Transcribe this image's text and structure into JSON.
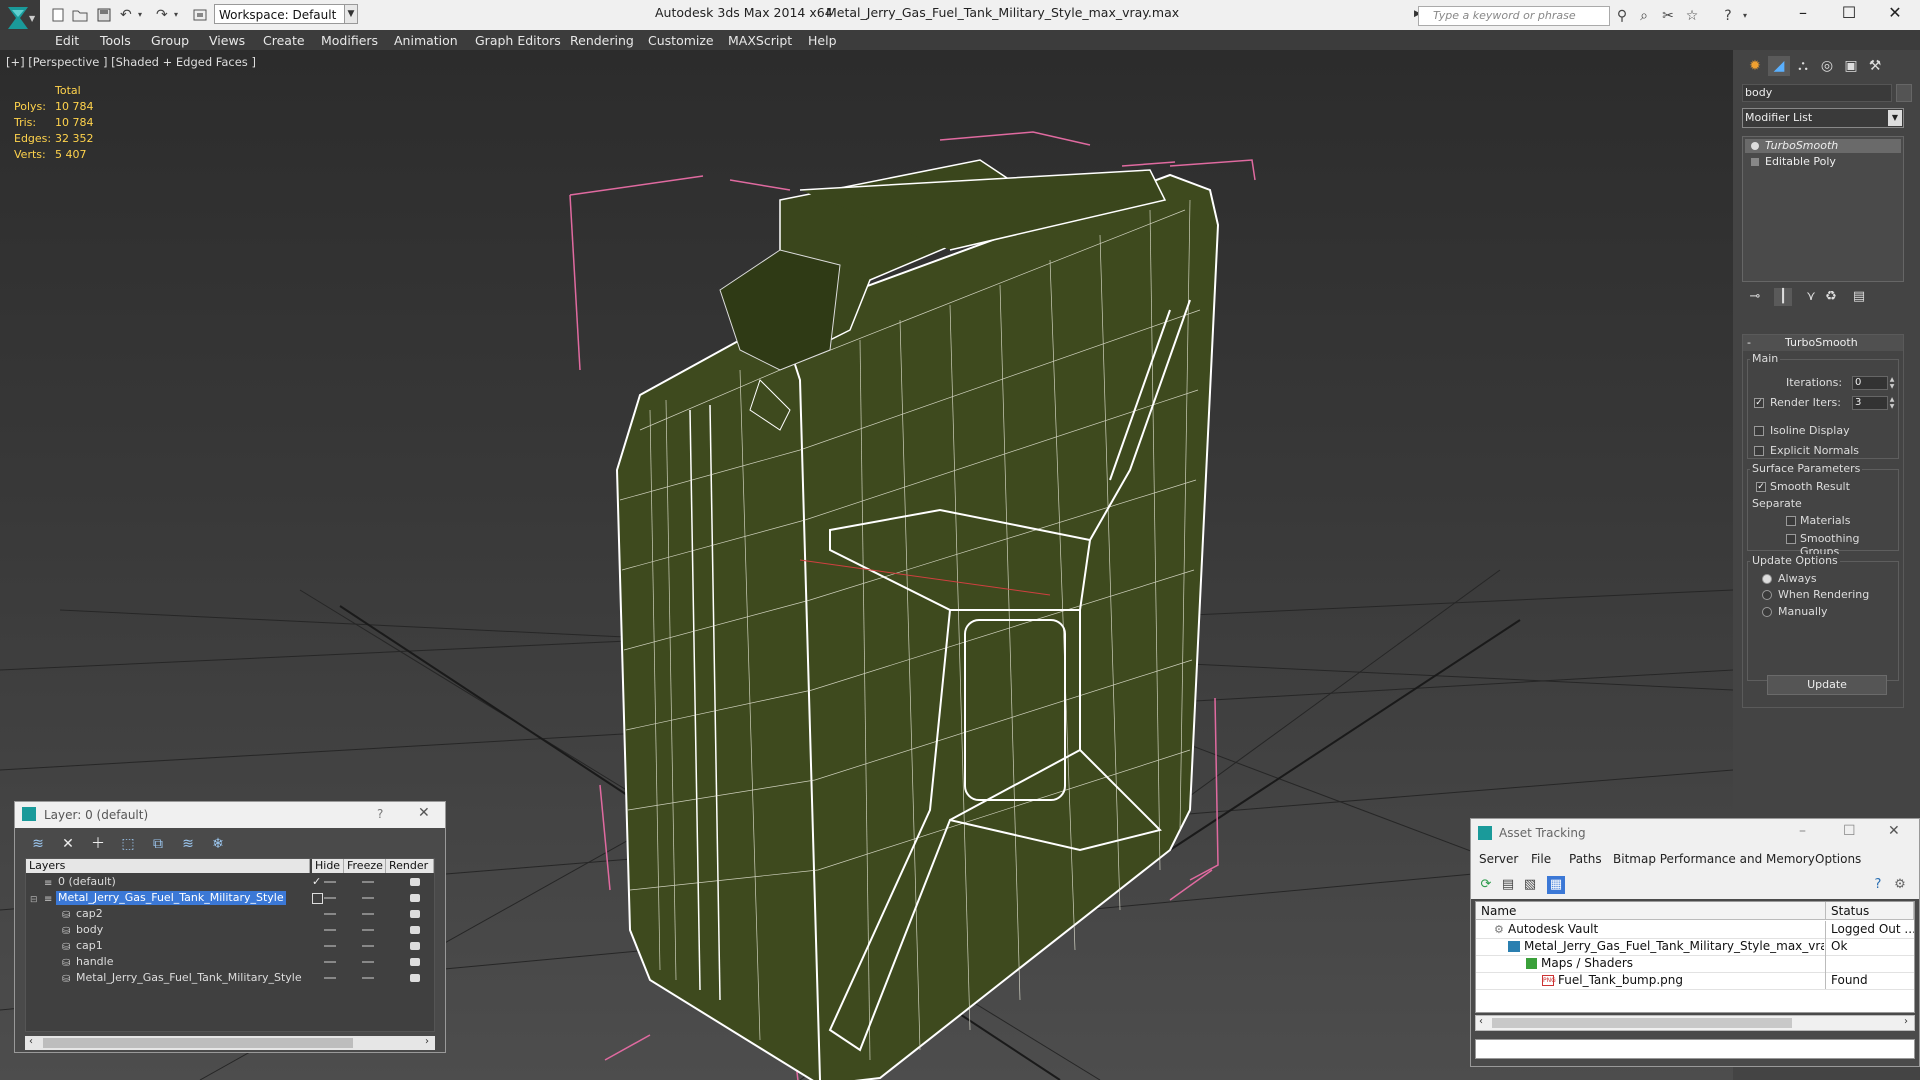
{
  "titlebar": {
    "workspace_label": "Workspace: Default",
    "app_title": "Autodesk 3ds Max  2014 x64",
    "file_title": "Metal_Jerry_Gas_Fuel_Tank_Military_Style_max_vray.max",
    "search_placeholder": "Type a keyword or phrase"
  },
  "menubar": [
    "Edit",
    "Tools",
    "Group",
    "Views",
    "Create",
    "Modifiers",
    "Animation",
    "Graph Editors",
    "Rendering",
    "Customize",
    "MAXScript",
    "Help"
  ],
  "viewport": {
    "label": "[+] [Perspective ] [Shaded + Edged Faces ]",
    "stats": {
      "header": "Total",
      "rows": [
        {
          "label": "Polys:",
          "value": "10 784"
        },
        {
          "label": "Tris:",
          "value": "10 784"
        },
        {
          "label": "Edges:",
          "value": "32 352"
        },
        {
          "label": "Verts:",
          "value": "5 407"
        }
      ]
    },
    "model_color": "#3e4a1e"
  },
  "command_panel": {
    "object_name": "body",
    "modifier_list": "Modifier List",
    "stack": [
      "TurboSmooth",
      "Editable Poly"
    ],
    "rollout_title": "TurboSmooth",
    "main_group": "Main",
    "iterations_label": "Iterations:",
    "iterations_value": "0",
    "render_iters_label": "Render Iters:",
    "render_iters_value": "3",
    "isoline_label": "Isoline Display",
    "explicit_normals_label": "Explicit Normals",
    "surface_group": "Surface Parameters",
    "smooth_result_label": "Smooth Result",
    "separate_label": "Separate",
    "materials_label": "Materials",
    "smoothing_groups_label": "Smoothing Groups",
    "update_group": "Update Options",
    "always_label": "Always",
    "when_rendering_label": "When Rendering",
    "manually_label": "Manually",
    "update_button": "Update"
  },
  "layer_window": {
    "title": "Layer: 0 (default)",
    "help": "?",
    "columns": [
      "Layers",
      "Hide",
      "Freeze",
      "Render"
    ],
    "rows": [
      {
        "name": "0 (default)",
        "indent": 0
      },
      {
        "name": "Metal_Jerry_Gas_Fuel_Tank_Military_Style",
        "indent": 0
      },
      {
        "name": "cap2",
        "indent": 1
      },
      {
        "name": "body",
        "indent": 1
      },
      {
        "name": "cap1",
        "indent": 1
      },
      {
        "name": "handle",
        "indent": 1
      },
      {
        "name": "Metal_Jerry_Gas_Fuel_Tank_Military_Style",
        "indent": 1
      }
    ]
  },
  "asset_window": {
    "title": "Asset Tracking",
    "menu": [
      "Server",
      "File",
      "Paths",
      "Bitmap Performance and Memory",
      "Options"
    ],
    "columns": [
      "Name",
      "Status"
    ],
    "rows": [
      {
        "name": "Autodesk Vault",
        "status": "Logged Out ..."
      },
      {
        "name": "Metal_Jerry_Gas_Fuel_Tank_Military_Style_max_vray....",
        "status": "Ok"
      },
      {
        "name": "Maps / Shaders",
        "status": ""
      },
      {
        "name": "Fuel_Tank_bump.png",
        "status": "Found"
      }
    ]
  }
}
